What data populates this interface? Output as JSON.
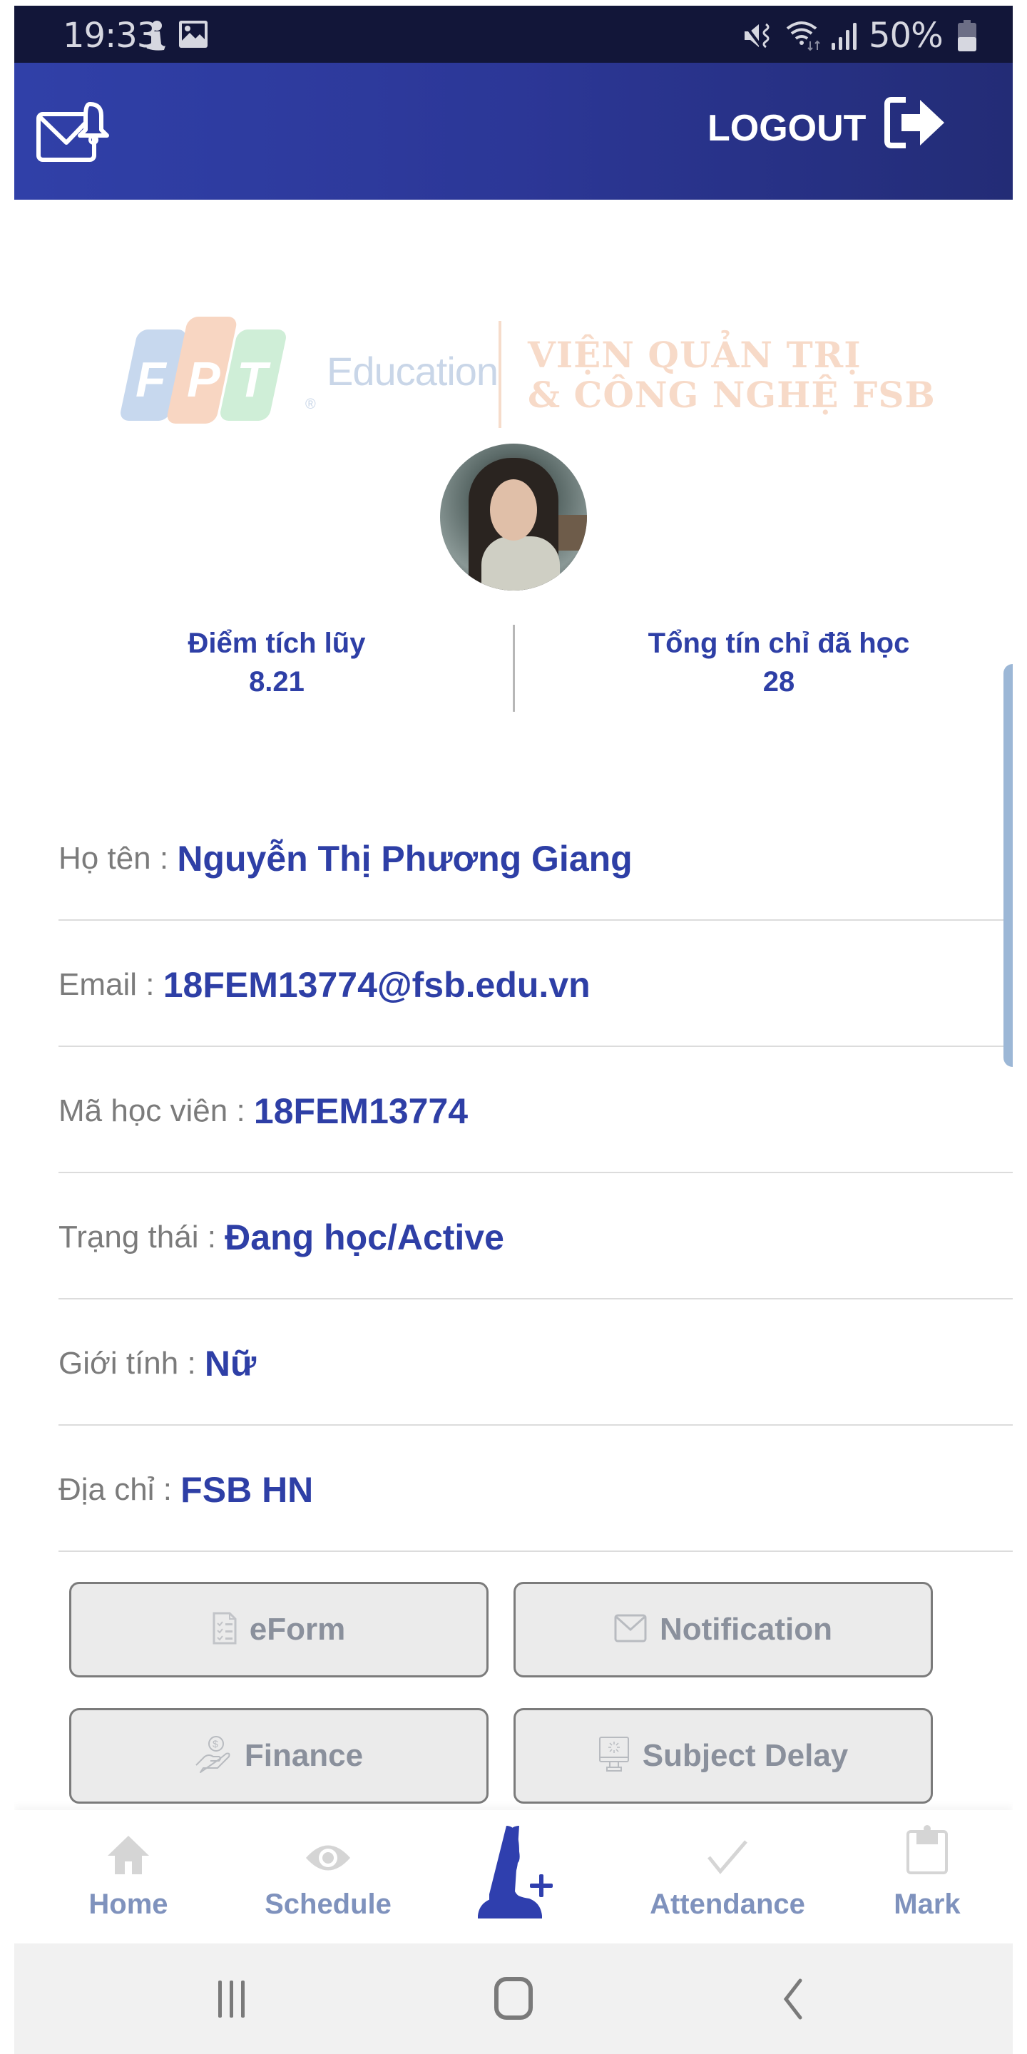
{
  "status_bar": {
    "time": "19:33",
    "left_icons": [
      "notification-person-icon",
      "gallery-icon"
    ],
    "right_icons": [
      "mute-vibrate-icon",
      "wifi-icon",
      "signal-icon",
      "battery-icon"
    ],
    "battery_percent": "50%"
  },
  "header": {
    "mail_icon": "mail-bell-icon",
    "logout_label": "LOGOUT",
    "logout_icon": "logout-icon",
    "colors": {
      "primary": "#2e3fa6",
      "dark": "#121639"
    }
  },
  "logo": {
    "brand_letters": [
      "F",
      "P",
      "T"
    ],
    "brand_text": "Education",
    "institute_line1": "VIỆN QUẢN TRỊ",
    "institute_line2": "& CÔNG NGHỆ FSB"
  },
  "profile": {
    "avatar_alt": "student-photo",
    "stats": [
      {
        "label": "Điểm tích lũy",
        "value": "8.21"
      },
      {
        "label": "Tổng tín chỉ đã học",
        "value": "28"
      }
    ],
    "fields": [
      {
        "label": "Họ tên : ",
        "value": "Nguyễn Thị Phương Giang"
      },
      {
        "label": "Email : ",
        "value": "18FEM13774@fsb.edu.vn"
      },
      {
        "label": "Mã học viên : ",
        "value": "18FEM13774"
      },
      {
        "label": "Trạng thái : ",
        "value": "Đang học/Active"
      },
      {
        "label": "Giới tính : ",
        "value": "Nữ"
      },
      {
        "label": "Địa chỉ : ",
        "value": "FSB HN"
      }
    ]
  },
  "actions": [
    {
      "label": "eForm",
      "icon": "form-checklist-icon"
    },
    {
      "label": "Notification",
      "icon": "envelope-icon"
    },
    {
      "label": "Finance",
      "icon": "hand-coin-icon"
    },
    {
      "label": "Subject Delay",
      "icon": "monitor-loading-icon"
    }
  ],
  "bottom_nav": {
    "items": [
      {
        "label": "Home",
        "icon": "home-icon"
      },
      {
        "label": "Schedule",
        "icon": "eye-icon"
      },
      {
        "label": "",
        "icon": "add-user-icon",
        "active": true
      },
      {
        "label": "Attendance",
        "icon": "check-icon"
      },
      {
        "label": "Mark",
        "icon": "clipboard-icon"
      }
    ]
  },
  "system_nav": {
    "buttons": [
      "recent-apps-icon",
      "home-circle-icon",
      "back-icon"
    ]
  }
}
